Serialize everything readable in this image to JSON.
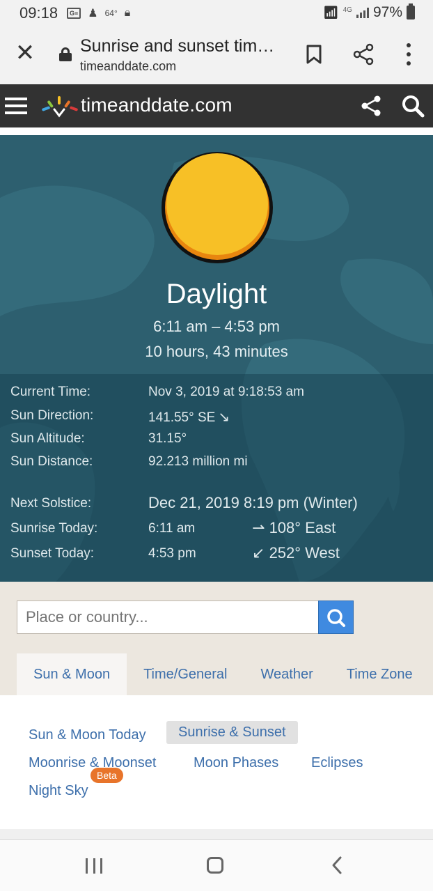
{
  "status_bar": {
    "time": "09:18",
    "temperature": "64°",
    "network": "4G",
    "battery": "97%"
  },
  "browser": {
    "page_title": "Sunrise and sunset tim…",
    "url": "timeanddate.com"
  },
  "site": {
    "logo_text": "timeanddate.com"
  },
  "hero": {
    "title": "Daylight",
    "range": "6:11 am – 4:53 pm",
    "length": "10 hours, 43 minutes"
  },
  "details": [
    {
      "label": "Current Time:",
      "value": "Nov 3, 2019 at 9:18:53 am"
    },
    {
      "label": "Sun Direction:",
      "value": "141.55° SE"
    },
    {
      "label": "Sun Altitude:",
      "value": "31.15°"
    },
    {
      "label": "Sun Distance:",
      "value": "92.213 million mi"
    },
    {
      "label": "Next Solstice:",
      "value": "Dec 21, 2019 8:19 pm (Winter)"
    },
    {
      "label": "Sunrise Today:",
      "value": "6:11 am",
      "direction": "108° East"
    },
    {
      "label": "Sunset Today:",
      "value": "4:53 pm",
      "direction": "252° West"
    }
  ],
  "search": {
    "placeholder": "Place or country..."
  },
  "tabs": [
    "Sun & Moon",
    "Time/General",
    "Weather",
    "Time Zone"
  ],
  "subnav": {
    "items": [
      "Sun & Moon Today",
      "Sunrise & Sunset",
      "Moonrise & Moonset",
      "Moon Phases",
      "Eclipses",
      "Night Sky"
    ],
    "badge": "Beta"
  },
  "colors": {
    "hero_bg": "#2d5f6f",
    "link": "#3d6fab",
    "search_button": "#3f8ae0",
    "sun": "#f7c026",
    "badge": "#e8742a"
  }
}
